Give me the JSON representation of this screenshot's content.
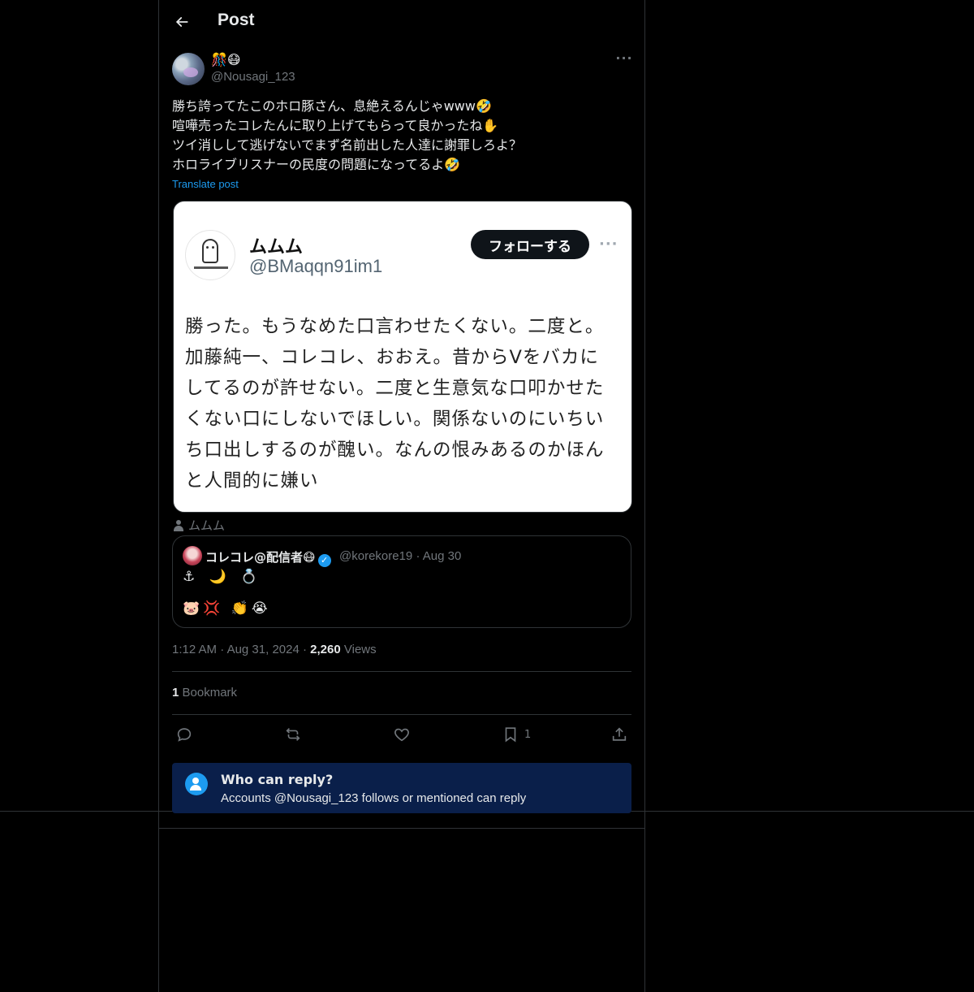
{
  "header": {
    "title": "Post"
  },
  "post": {
    "display_name": "🎊😷",
    "handle": "@Nousagi_123",
    "more_label": "···",
    "lines": [
      "勝ち誇ってたこのホロ豚さん、息絶えるんじゃwww🤣",
      "喧嘩売ったコレたんに取り上げてもらって良かったね✋",
      "ツイ消しして逃げないでまず名前出した人達に謝罪しろよ？",
      "ホロライブリスナーの民度の問題になってるよ🤣"
    ],
    "translate_label": "Translate post"
  },
  "screenshot": {
    "name": "ムムム",
    "handle": "@BMaqqn91im1",
    "follow_label": "フォローする",
    "more_label": "···",
    "lines": [
      "勝った。もうなめた口言わせたくない。二度と。",
      "加藤純一、コレコレ、おおえ。昔からVをバカに",
      "してるのが許せない。二度と生意気な口叩かせた",
      "くない口にしないでほしい。関係ないのにいちい",
      "ち口出しするのが醜い。なんの恨みあるのかほん",
      "と人間的に嫌い"
    ]
  },
  "alt_author": "ムムム",
  "quote": {
    "name": "コレコレ@配信者😷",
    "verified_mark": "✓",
    "handle_date": "@korekore19 · Aug 30",
    "line1": "⚓ 🌙 💍",
    "line2": "🐷💢 👏😭"
  },
  "meta": {
    "time": "1:12 AM",
    "sep": "·",
    "date": "Aug 31, 2024",
    "views_count": "2,260",
    "views_label": "Views"
  },
  "bookmarks": {
    "count": "1",
    "label": "Bookmark"
  },
  "actions": {
    "bookmark_count": "1"
  },
  "reply_info": {
    "title": "Who can reply?",
    "subtitle": "Accounts @Nousagi_123 follows or mentioned can reply"
  },
  "colors": {
    "accent": "#1d9bf0",
    "background": "#000000",
    "muted": "#71767b",
    "reply_box": "#0a1f4a"
  }
}
